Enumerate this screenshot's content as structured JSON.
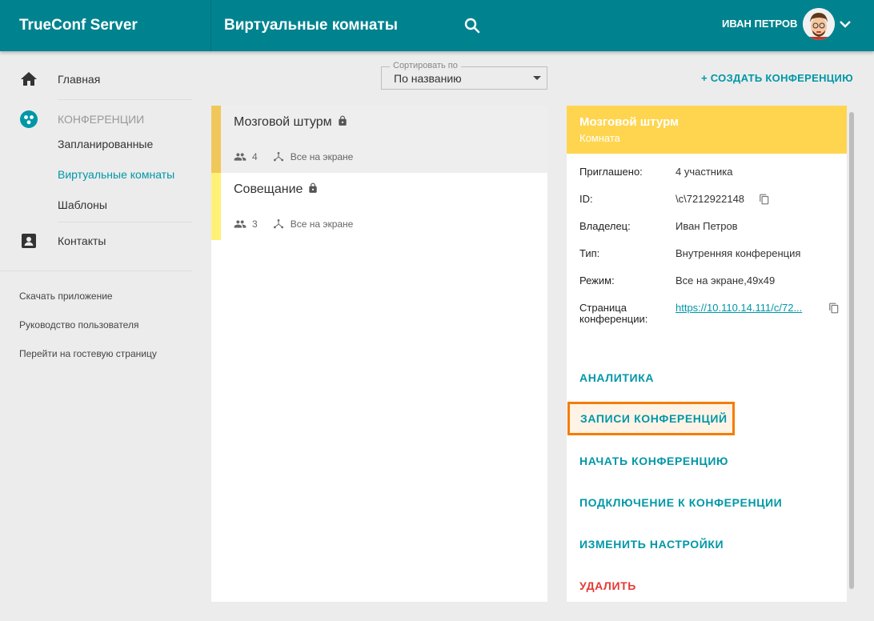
{
  "header": {
    "brand": "TrueConf Server",
    "title": "Виртуальные комнаты",
    "user_name": "ИВАН ПЕТРОВ",
    "color": "#00838f"
  },
  "sidebar": {
    "home": "Главная",
    "conferences_section": "КОНФЕРЕНЦИИ",
    "scheduled": "Запланированные",
    "virtual_rooms": "Виртуальные комнаты",
    "templates": "Шаблоны",
    "contacts": "Контакты",
    "links": [
      "Скачать приложение",
      "Руководство пользователя",
      "Перейти на гостевую страницу"
    ]
  },
  "sort": {
    "legend": "Сортировать по",
    "value": "По названию"
  },
  "create_button": "+ СОЗДАТЬ КОНФЕРЕНЦИЮ",
  "conferences": [
    {
      "name": "Мозговой штурм",
      "participants": "4",
      "mode": "Все на экране",
      "bar_color": "#f0c85a",
      "selected": true
    },
    {
      "name": "Совещание",
      "participants": "3",
      "mode": "Все на экране",
      "bar_color": "#fff176",
      "selected": false
    }
  ],
  "details": {
    "title": "Мозговой штурм",
    "subtitle": "Комната",
    "header_color": "#ffd54f",
    "fields": [
      {
        "label": "Приглашено:",
        "value": "4 участника"
      },
      {
        "label": "ID:",
        "value": "\\c\\7212922148"
      },
      {
        "label": "Владелец:",
        "value": "Иван Петров"
      },
      {
        "label": "Тип:",
        "value": "Внутренняя конференция"
      },
      {
        "label": "Режим:",
        "value": "Все на экране,49x49"
      },
      {
        "label_line1": "Страница",
        "label_line2": "конференции:",
        "value": "https://10.110.14.111/c/72..."
      }
    ],
    "actions": {
      "analytics": "АНАЛИТИКА",
      "recordings": "ЗАПИСИ КОНФЕРЕНЦИЙ",
      "start": "НАЧАТЬ КОНФЕРЕНЦИЮ",
      "connect": "ПОДКЛЮЧЕНИЕ К КОНФЕРЕНЦИИ",
      "settings": "ИЗМЕНИТЬ НАСТРОЙКИ",
      "delete": "УДАЛИТЬ"
    }
  }
}
